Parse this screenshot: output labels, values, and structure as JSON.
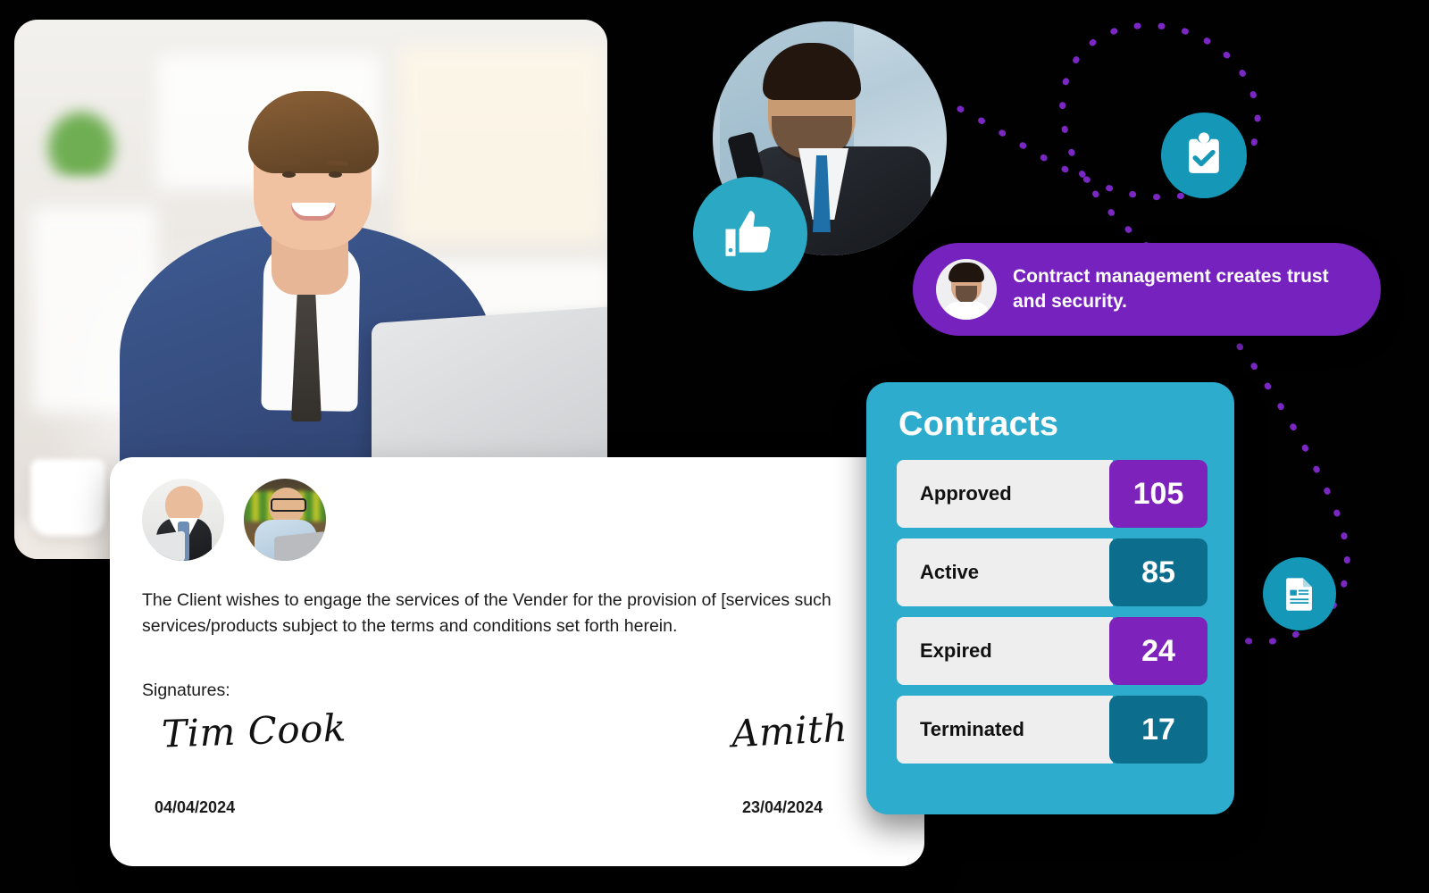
{
  "contracts_card": {
    "title": "Contracts",
    "rows": [
      {
        "label": "Approved",
        "value": "105",
        "color": "#7d22bb"
      },
      {
        "label": "Active",
        "value": "85",
        "color": "#0c6e8c"
      },
      {
        "label": "Expired",
        "value": "24",
        "color": "#7d22bb"
      },
      {
        "label": "Terminated",
        "value": "17",
        "color": "#0c6e8c"
      }
    ]
  },
  "message_bubble": {
    "text": "Contract management  creates trust and security.",
    "avatar": "user-avatar",
    "background": "#7622be"
  },
  "contract_document": {
    "paragraph": "The Client wishes to engage the services of the Vender for the provision of [services such services/products subject to the terms and conditions set forth herein.",
    "signatures_label": "Signatures:",
    "signature_left": "Tim Cook",
    "signature_right": "Amith",
    "date_left": "04/04/2024",
    "date_right": "23/04/2024",
    "avatars": [
      "businessman-avatar-1",
      "businessman-avatar-2"
    ]
  },
  "icons": {
    "thumbs_up": "thumbs-up-icon",
    "clipboard_check": "clipboard-check-icon",
    "document": "document-icon"
  },
  "photos": {
    "hero": "businessman-at-laptop-photo",
    "portrait": "businessman-with-phone-photo"
  },
  "theme": {
    "teal": "#2dacce",
    "teal_dark": "#0c6e8c",
    "purple": "#7622be",
    "icon_teal": "#1597b8",
    "background": "#010101",
    "dot_purple": "#7b27c4"
  }
}
